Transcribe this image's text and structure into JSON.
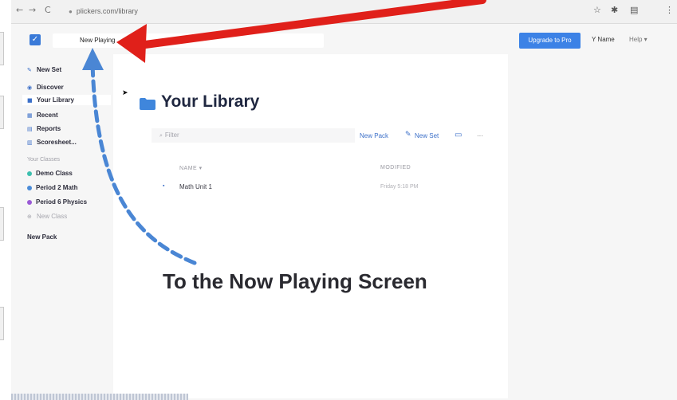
{
  "browser": {
    "back": "←",
    "forward": "→",
    "reload": "C",
    "url": "plickers.com/library",
    "ext_icons": [
      "☆",
      "✱",
      "▤",
      "⋮"
    ]
  },
  "header": {
    "now_playing": "New Playing",
    "upgrade": "Upgrade to Pro",
    "user": "Y Name",
    "help": "Help ▾"
  },
  "sidebar": {
    "new_set": "New Set",
    "discover": "Discover",
    "your_library": "Your Library",
    "recent": "Recent",
    "reports": "Reports",
    "scoresheet": "Scoresheet...",
    "classes_caption": "Your Classes",
    "classes": [
      {
        "label": "Demo Class",
        "color": "#3cbfae"
      },
      {
        "label": "Period 2 Math",
        "color": "#4a8bd8"
      },
      {
        "label": "Period 6 Physics",
        "color": "#9a5ad6"
      }
    ],
    "new_class": "New Class",
    "new_pack": "New Pack"
  },
  "library": {
    "title": "Your Library",
    "filter_placeholder": "Filter",
    "new_pack": "New Pack",
    "new_set": "New Set",
    "more": "···",
    "col_name": "NAME ▾",
    "col_modified": "MODIFIED",
    "rows": [
      {
        "name": "Math Unit 1",
        "modified": "Friday 5:18 PM"
      }
    ]
  },
  "annotation": {
    "caption": "To the Now Playing Screen",
    "arrow_color": "#e0201a",
    "curve_color": "#4a86d4"
  }
}
